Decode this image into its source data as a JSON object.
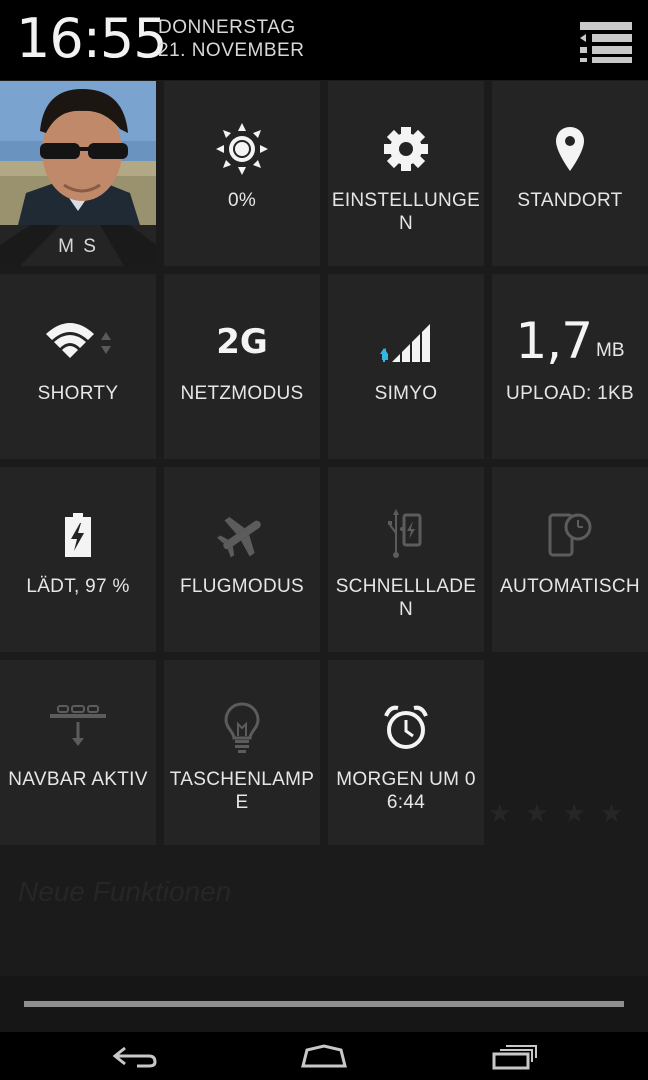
{
  "status": {
    "time": "16:55",
    "day": "DONNERSTAG",
    "date": "21. NOVEMBER"
  },
  "tiles": {
    "user": {
      "name": "M S"
    },
    "brightness": {
      "label": "0%",
      "icon": "brightness-icon"
    },
    "settings": {
      "label": "EINSTELLUNGEN",
      "icon": "gear-icon"
    },
    "location": {
      "label": "STANDORT",
      "icon": "location-pin-icon"
    },
    "wifi": {
      "label": "SHORTY",
      "icon": "wifi-icon"
    },
    "network_mode": {
      "label": "NETZMODUS",
      "value": "2G"
    },
    "carrier": {
      "label": "SIMYO",
      "icon": "signal-icon"
    },
    "data_usage": {
      "value": "1,7",
      "unit": "MB",
      "label": "UPLOAD: 1KB"
    },
    "battery": {
      "label": "LÄDT, 97 %",
      "icon": "battery-charging-icon",
      "level_percent": 97
    },
    "airplane": {
      "label": "FLUGMODUS",
      "icon": "airplane-icon"
    },
    "fast_charge": {
      "label": "SCHNELLLADEN",
      "icon": "usb-charge-icon"
    },
    "auto_rotate": {
      "label": "AUTOMATISCH",
      "icon": "phone-clock-icon"
    },
    "navbar": {
      "label": "NAVBAR AKTIV",
      "icon": "navbar-icon"
    },
    "flashlight": {
      "label": "TASCHENLAMPE",
      "icon": "lightbulb-icon"
    },
    "alarm": {
      "label": "MORGEN UM 06:44",
      "icon": "alarm-clock-icon"
    }
  },
  "background": {
    "ghost_text": "Neue Funktionen"
  },
  "colors": {
    "accent_blue": "#33b5e5",
    "tile_bg": "#242424"
  }
}
